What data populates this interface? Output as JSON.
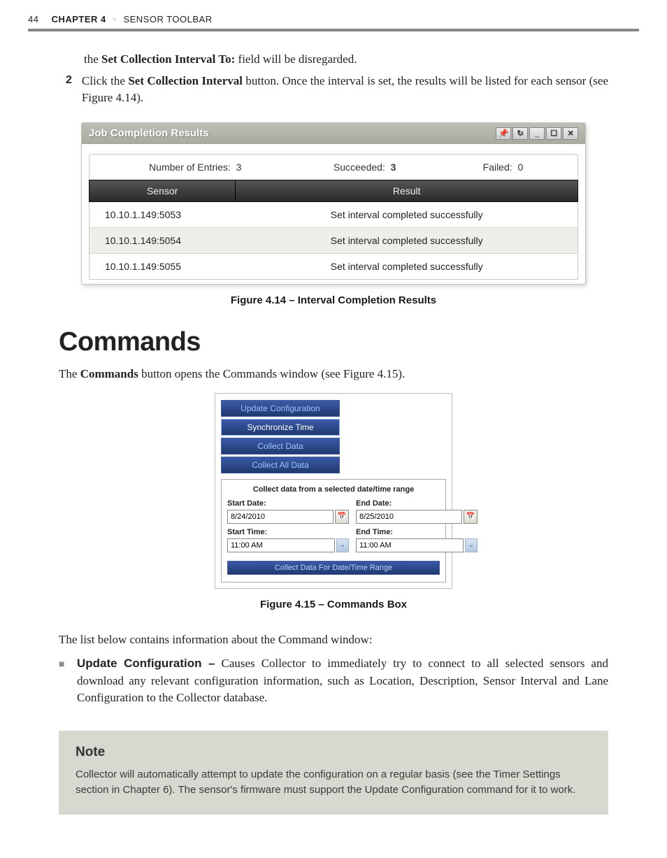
{
  "header": {
    "page_num": "44",
    "chapter_label": "CHAPTER 4",
    "chapter_title": "SENSOR TOOLBAR"
  },
  "intro_line": "the Set Collection Interval To: field will be disregarded.",
  "intro_bold": "Set Collection Interval To:",
  "step": {
    "num": "2",
    "text_pre": "Click the ",
    "bold": "Set Collection Interval",
    "text_post": " button. Once the interval is set, the results will be listed for each sensor (see Figure 4.14)."
  },
  "fig414": {
    "title": "Job Completion Results",
    "summary": {
      "entries_label": "Number of Entries:",
      "entries_val": "3",
      "succeeded_label": "Succeeded:",
      "succeeded_val": "3",
      "failed_label": "Failed:",
      "failed_val": "0"
    },
    "headers": {
      "sensor": "Sensor",
      "result": "Result"
    },
    "rows": [
      {
        "sensor": "10.10.1.149:5053",
        "result": "Set interval completed successfully"
      },
      {
        "sensor": "10.10.1.149:5054",
        "result": "Set interval completed successfully"
      },
      {
        "sensor": "10.10.1.149:5055",
        "result": "Set interval completed successfully"
      }
    ],
    "caption": "Figure 4.14 – Interval Completion Results"
  },
  "commands_heading": "Commands",
  "commands_intro_pre": "The ",
  "commands_intro_bold": "Commands",
  "commands_intro_post": " button opens the Commands window (see Figure 4.15).",
  "fig415": {
    "buttons": {
      "update": "Update Configuration",
      "sync": "Synchronize Time",
      "collect": "Collect Data",
      "collect_all": "Collect All Data"
    },
    "box_title": "Collect data from a selected date/time range",
    "start_date_label": "Start Date:",
    "end_date_label": "End Date:",
    "start_time_label": "Start Time:",
    "end_time_label": "End Time:",
    "start_date": "8/24/2010",
    "end_date": "8/25/2010",
    "start_time": "11:00 AM",
    "end_time": "11:00 AM",
    "collect_range_btn": "Collect Data For Date/Time Range",
    "caption": "Figure 4.15 – Commands Box"
  },
  "list_intro": "The list below contains information about the Command window:",
  "bullet": {
    "title": "Update Configuration –",
    "body": " Causes Collector to immediately try to connect to all selected sensors and download any relevant configuration information, such as Location, Description, Sensor Interval and Lane Configuration to the Collector database."
  },
  "note": {
    "heading": "Note",
    "body": "Collector will automatically attempt to update the configuration on a regular basis (see the Timer Settings section in Chapter 6). The sensor's firmware must support the Update Configuration command for it to work."
  }
}
